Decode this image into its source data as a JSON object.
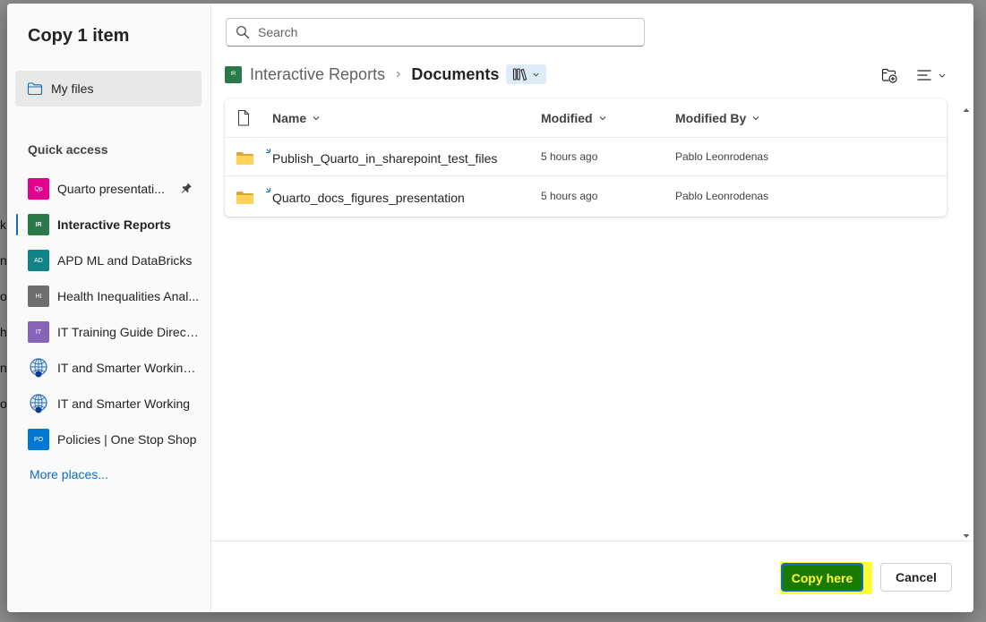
{
  "background": {
    "fragments": [
      "k",
      "na",
      "o",
      "he",
      "ne",
      "o"
    ]
  },
  "dialog": {
    "title": "Copy 1 item"
  },
  "left_pane": {
    "my_files_label": "My files",
    "quick_access_heading": "Quick access",
    "sites": [
      {
        "initials": "Qp",
        "label": "Quarto presentati...",
        "color": "#e3008c",
        "pinned": true,
        "active": false
      },
      {
        "initials": "IR",
        "label": "Interactive Reports",
        "color": "#2a7a49",
        "pinned": false,
        "active": true
      },
      {
        "initials": "AD",
        "label": "APD ML and DataBricks",
        "color": "#108387",
        "pinned": false,
        "active": false
      },
      {
        "initials": "HI",
        "label": "Health Inequalities Anal...",
        "color": "#6e6e6e",
        "pinned": false,
        "active": false
      },
      {
        "initials": "IT",
        "label": "IT Training Guide Direct...",
        "color": "#8764b8",
        "pinned": false,
        "active": false
      },
      {
        "initials": "",
        "label": "IT and Smarter Working...",
        "color": "globe",
        "pinned": false,
        "active": false
      },
      {
        "initials": "",
        "label": "IT and Smarter Working",
        "color": "globe",
        "pinned": false,
        "active": false
      },
      {
        "initials": "PO",
        "label": "Policies | One Stop Shop",
        "color": "#0078d4",
        "pinned": false,
        "active": false
      }
    ],
    "more_places_label": "More places..."
  },
  "search": {
    "placeholder": "Search"
  },
  "breadcrumb": {
    "site_initials": "IR",
    "site": "Interactive Reports",
    "separator": "›",
    "current": "Documents"
  },
  "file_list": {
    "columns": {
      "name": "Name",
      "modified": "Modified",
      "modified_by": "Modified By"
    },
    "rows": [
      {
        "name": "Publish_Quarto_in_sharepoint_test_files",
        "modified": "5 hours ago",
        "modified_by": "Pablo Leonrodenas"
      },
      {
        "name": "Quarto_docs_figures_presentation",
        "modified": "5 hours ago",
        "modified_by": "Pablo Leonrodenas"
      }
    ]
  },
  "footer": {
    "copy_here_label": "Copy here",
    "cancel_label": "Cancel"
  }
}
